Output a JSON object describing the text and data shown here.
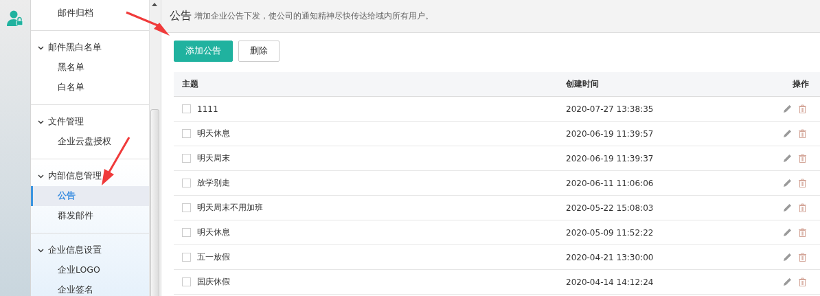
{
  "sidebar": {
    "groups": [
      {
        "items": [
          {
            "label": "邮件归档",
            "selected": false
          }
        ]
      },
      {
        "title": "邮件黑白名单",
        "expanded": true,
        "items": [
          {
            "label": "黑名单",
            "selected": false
          },
          {
            "label": "白名单",
            "selected": false
          }
        ]
      },
      {
        "title": "文件管理",
        "expanded": true,
        "items": [
          {
            "label": "企业云盘授权",
            "selected": false
          }
        ]
      },
      {
        "title": "内部信息管理",
        "expanded": true,
        "items": [
          {
            "label": "公告",
            "selected": true
          },
          {
            "label": "群发邮件",
            "selected": false
          }
        ]
      },
      {
        "title": "企业信息设置",
        "expanded": true,
        "items": [
          {
            "label": "企业LOGO",
            "selected": false
          },
          {
            "label": "企业签名",
            "selected": false
          }
        ]
      }
    ]
  },
  "header": {
    "title": "公告",
    "description": "增加企业公告下发，使公司的通知精神尽快传达给域内所有用户。"
  },
  "buttons": [
    {
      "label": "添加公告",
      "kind": "primary"
    },
    {
      "label": "删除",
      "kind": "default"
    }
  ],
  "table": {
    "columns": [
      "主题",
      "创建时间",
      "操作"
    ],
    "rows": [
      {
        "subject": "1111",
        "created": "2020-07-27 13:38:35",
        "checked": false
      },
      {
        "subject": "明天休息",
        "created": "2020-06-19 11:39:57",
        "checked": false
      },
      {
        "subject": "明天周末",
        "created": "2020-06-19 11:39:37",
        "checked": false
      },
      {
        "subject": "放学别走",
        "created": "2020-06-11 11:06:06",
        "checked": false
      },
      {
        "subject": "明天周末不用加班",
        "created": "2020-05-22 15:08:03",
        "checked": false
      },
      {
        "subject": "明天休息",
        "created": "2020-05-09 11:52:22",
        "checked": false
      },
      {
        "subject": "五一放假",
        "created": "2020-04-21 13:30:00",
        "checked": false
      },
      {
        "subject": "国庆休假",
        "created": "2020-04-14 14:12:24",
        "checked": false
      }
    ]
  }
}
